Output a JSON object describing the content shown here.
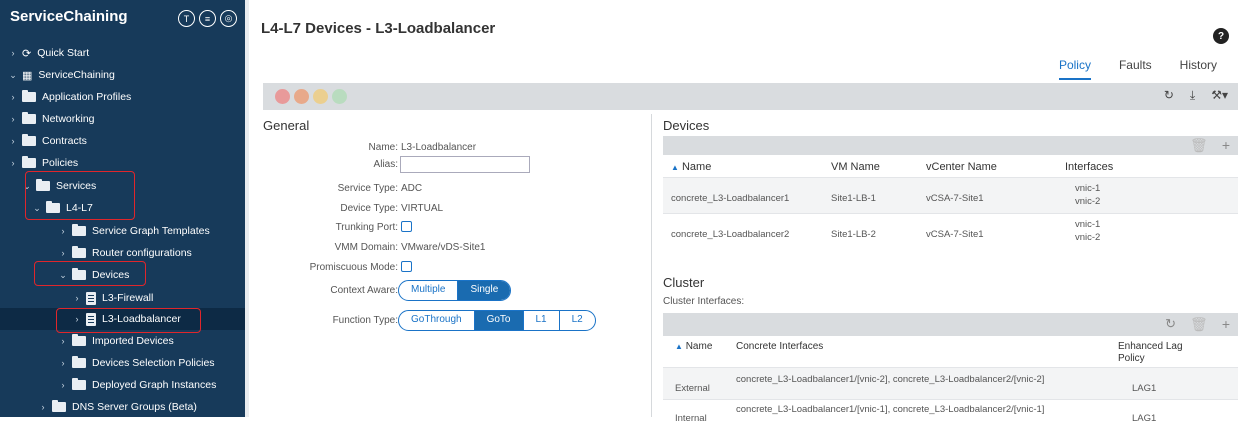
{
  "sidebar": {
    "title": "ServiceChaining",
    "items": [
      {
        "label": "Quick Start"
      },
      {
        "label": "ServiceChaining"
      },
      {
        "label": "Application Profiles"
      },
      {
        "label": "Networking"
      },
      {
        "label": "Contracts"
      },
      {
        "label": "Policies"
      },
      {
        "label": "Services"
      },
      {
        "label": "L4-L7"
      },
      {
        "label": "Service Graph Templates"
      },
      {
        "label": "Router configurations"
      },
      {
        "label": "Devices"
      },
      {
        "label": "L3-Firewall"
      },
      {
        "label": "L3-Loadbalancer"
      },
      {
        "label": "Imported Devices"
      },
      {
        "label": "Devices Selection Policies"
      },
      {
        "label": "Deployed Graph Instances"
      },
      {
        "label": "DNS Server Groups (Beta)"
      }
    ]
  },
  "page": {
    "title": "L4-L7 Devices - L3-Loadbalancer",
    "tabs": [
      "Policy",
      "Faults",
      "History"
    ],
    "active_tab": "Policy"
  },
  "general": {
    "title": "General",
    "name_label": "Name:",
    "name_value": "L3-Loadbalancer",
    "alias_label": "Alias:",
    "alias_value": "",
    "service_type_label": "Service Type:",
    "service_type_value": "ADC",
    "device_type_label": "Device Type:",
    "device_type_value": "VIRTUAL",
    "trunking_label": "Trunking Port:",
    "vmm_label": "VMM Domain:",
    "vmm_value": "VMware/vDS-Site1",
    "promiscuous_label": "Promiscuous Mode:",
    "context_aware_label": "Context Aware:",
    "context_options": [
      "Multiple",
      "Single"
    ],
    "context_selected": "Single",
    "function_type_label": "Function Type:",
    "function_options": [
      "GoThrough",
      "GoTo",
      "L1",
      "L2"
    ],
    "function_selected": "GoTo"
  },
  "devices": {
    "title": "Devices",
    "columns": [
      "Name",
      "VM Name",
      "vCenter Name",
      "Interfaces"
    ],
    "rows": [
      {
        "name": "concrete_L3-Loadbalancer1",
        "vm": "Site1-LB-1",
        "vcenter": "vCSA-7-Site1",
        "if1": "vnic-1",
        "if2": "vnic-2"
      },
      {
        "name": "concrete_L3-Loadbalancer2",
        "vm": "Site1-LB-2",
        "vcenter": "vCSA-7-Site1",
        "if1": "vnic-1",
        "if2": "vnic-2"
      }
    ]
  },
  "cluster": {
    "title": "Cluster",
    "subtitle": "Cluster Interfaces:",
    "columns": [
      "Name",
      "Concrete Interfaces",
      "Enhanced Lag",
      "Policy"
    ],
    "rows": [
      {
        "name": "External",
        "interfaces": "concrete_L3-Loadbalancer1/[vnic-2], concrete_L3-Loadbalancer2/[vnic-2]",
        "lag": "LAG1"
      },
      {
        "name": "Internal",
        "interfaces": "concrete_L3-Loadbalancer1/[vnic-1], concrete_L3-Loadbalancer2/[vnic-1]",
        "lag": "LAG1"
      }
    ]
  },
  "colors": {
    "sidebar_bg": "#173a5a",
    "accent": "#1a73c7",
    "highlight_box": "#e0262b"
  }
}
